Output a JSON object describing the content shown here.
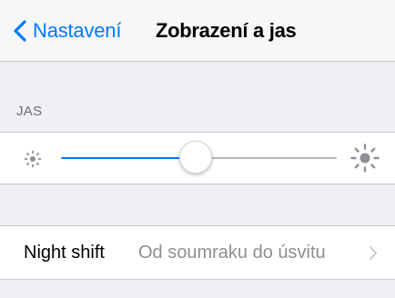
{
  "navbar": {
    "back_label": "Nastavení",
    "title": "Zobrazení a jas"
  },
  "brightness": {
    "section_header": "JAS",
    "level_fraction": 0.49,
    "min_icon": "sun-small-icon",
    "max_icon": "sun-large-icon"
  },
  "night_shift": {
    "label": "Night shift",
    "value": "Od soumraku do úsvitu",
    "chevron_icon": "chevron-right-icon"
  },
  "colors": {
    "accent": "#007aff",
    "background": "#efeff4",
    "secondary_text": "#8e8e93",
    "section_header": "#6d6d72"
  }
}
